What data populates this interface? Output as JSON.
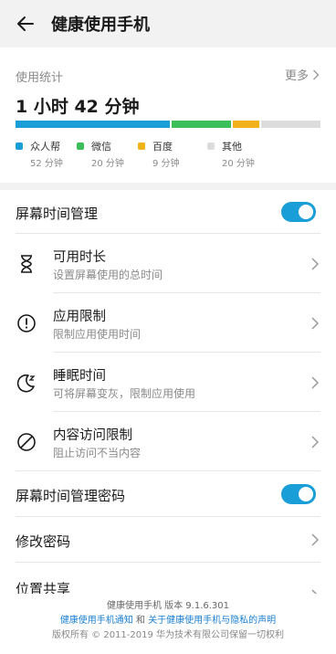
{
  "header": {
    "title": "健康使用手机"
  },
  "stats": {
    "label": "使用统计",
    "more": "更多",
    "total": "1 小时 42 分钟",
    "apps": [
      {
        "name": "众人帮",
        "minutes": "52 分钟",
        "value": 52,
        "color": "#1a9ed8"
      },
      {
        "name": "微信",
        "minutes": "20 分钟",
        "value": 20,
        "color": "#3cbf5a"
      },
      {
        "name": "百度",
        "minutes": "9 分钟",
        "value": 9,
        "color": "#f2b21c"
      },
      {
        "name": "其他",
        "minutes": "20 分钟",
        "value": 20,
        "color": "#dcdcdc"
      }
    ]
  },
  "screen_time": {
    "label": "屏幕时间管理",
    "toggle_on": true,
    "items": [
      {
        "title": "可用时长",
        "subtitle": "设置屏幕使用的总时间",
        "icon": "hourglass-icon"
      },
      {
        "title": "应用限制",
        "subtitle": "限制应用使用时间",
        "icon": "alert-circle-icon"
      },
      {
        "title": "睡眠时间",
        "subtitle": "可将屏幕变灰，限制应用使用",
        "icon": "moon-sleep-icon"
      },
      {
        "title": "内容访问限制",
        "subtitle": "阻止访问不当内容",
        "icon": "block-icon"
      }
    ]
  },
  "password": {
    "label": "屏幕时间管理密码",
    "toggle_on": true
  },
  "change_password": {
    "label": "修改密码"
  },
  "location_share": {
    "label": "位置共享"
  },
  "footer": {
    "version": "健康使用手机 版本 9.1.6.301",
    "link1": "健康使用手机通知",
    "and": "和",
    "link2": "关于健康使用手机与隐私的声明",
    "copyright": "版权所有 © 2011-2019 华为技术有限公司保留一切权利"
  }
}
